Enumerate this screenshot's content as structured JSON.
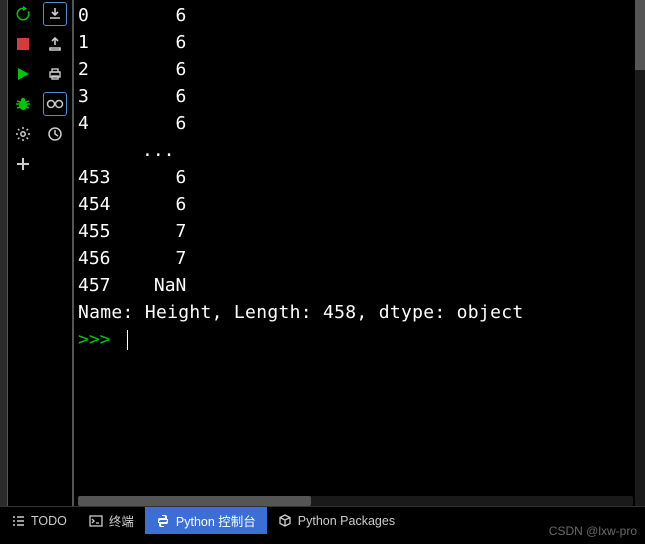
{
  "toolbar1": {
    "items": [
      {
        "name": "rerun-icon",
        "color": "#00c800"
      },
      {
        "name": "stop-icon",
        "color": "#d63a3a"
      },
      {
        "name": "play-icon",
        "color": "#00c800"
      },
      {
        "name": "debug-icon",
        "color": "#00c800"
      },
      {
        "name": "settings-icon",
        "color": "#ccc"
      },
      {
        "name": "add-icon",
        "color": "#ccc"
      }
    ]
  },
  "toolbar2": {
    "items": [
      {
        "name": "import-icon",
        "boxed": true
      },
      {
        "name": "export-icon",
        "boxed": false
      },
      {
        "name": "print-icon",
        "boxed": false
      },
      {
        "name": "view-icon",
        "boxed": true
      },
      {
        "name": "history-icon",
        "boxed": false
      }
    ]
  },
  "console": {
    "rows_top": [
      {
        "idx": "0",
        "val": "6"
      },
      {
        "idx": "1",
        "val": "6"
      },
      {
        "idx": "2",
        "val": "6"
      },
      {
        "idx": "3",
        "val": "6"
      },
      {
        "idx": "4",
        "val": "6"
      }
    ],
    "ellipsis": "...",
    "rows_bottom": [
      {
        "idx": "453",
        "val": "6"
      },
      {
        "idx": "454",
        "val": "6"
      },
      {
        "idx": "455",
        "val": "7"
      },
      {
        "idx": "456",
        "val": "7"
      },
      {
        "idx": "457",
        "val": "NaN"
      }
    ],
    "summary": "Name: Height, Length: 458, dtype: object",
    "prompt": ">>>"
  },
  "bottom_tabs": {
    "todo": "TODO",
    "terminal": "终端",
    "python_console": "Python 控制台",
    "packages": "Python Packages"
  },
  "watermark": "CSDN @lxw-pro"
}
